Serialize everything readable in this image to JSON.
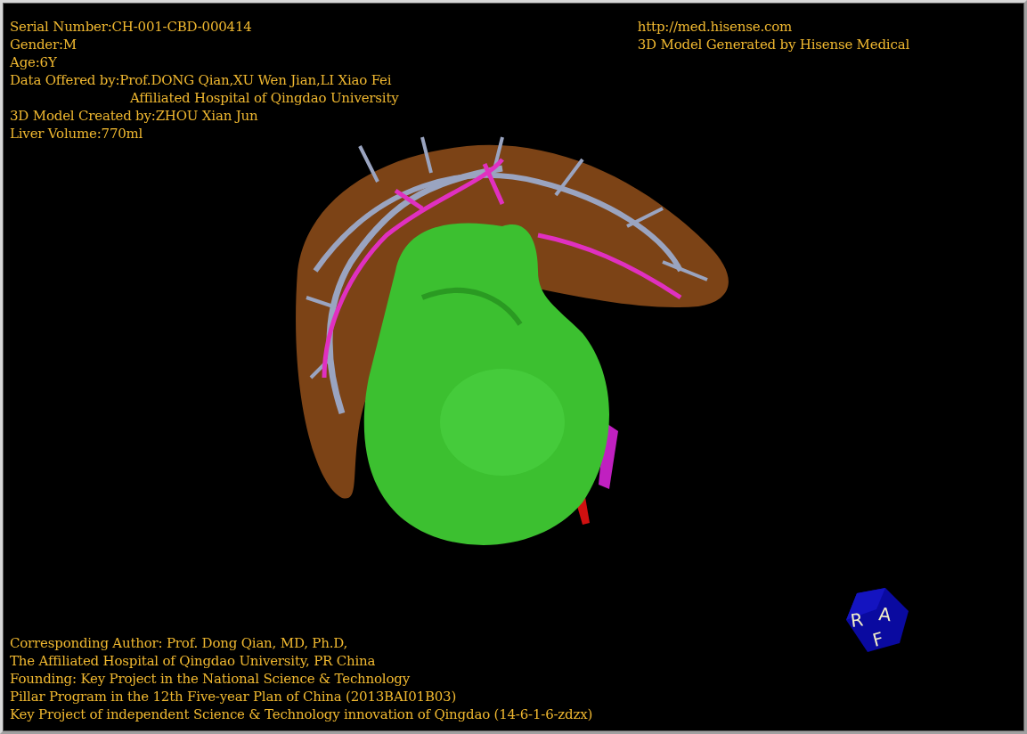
{
  "viewer": {
    "info_lines": [
      {
        "kind": "line",
        "text": "Serial Number:CH-001-CBD-000414"
      },
      {
        "kind": "line",
        "text": "Gender:M"
      },
      {
        "kind": "line",
        "text": "Age:6Y"
      },
      {
        "kind": "line",
        "text": "Data Offered by:Prof.DONG Qian,XU Wen Jian,LI Xiao Fei"
      },
      {
        "kind": "indent",
        "text": "Affiliated Hospital of Qingdao University"
      },
      {
        "kind": "line",
        "text": "3D Model Created by:ZHOU Xian Jun"
      },
      {
        "kind": "line",
        "text": "Liver Volume:770ml"
      }
    ],
    "credit_lines": [
      "http://med.hisense.com",
      "3D Model Generated by Hisense Medical"
    ],
    "footer_lines": [
      "Corresponding Author: Prof. Dong Qian, MD, Ph.D,",
      "The Affiliated Hospital of Qingdao University, PR China",
      "Founding: Key Project in the National Science & Technology",
      "Pillar Program in the 12th Five-year Plan of China (2013BAI01B03)",
      "Key Project of independent Science & Technology innovation of Qingdao (14-6-1-6-zdzx)"
    ],
    "orientation_cube": {
      "labels": [
        "R",
        "A",
        "F"
      ]
    }
  }
}
